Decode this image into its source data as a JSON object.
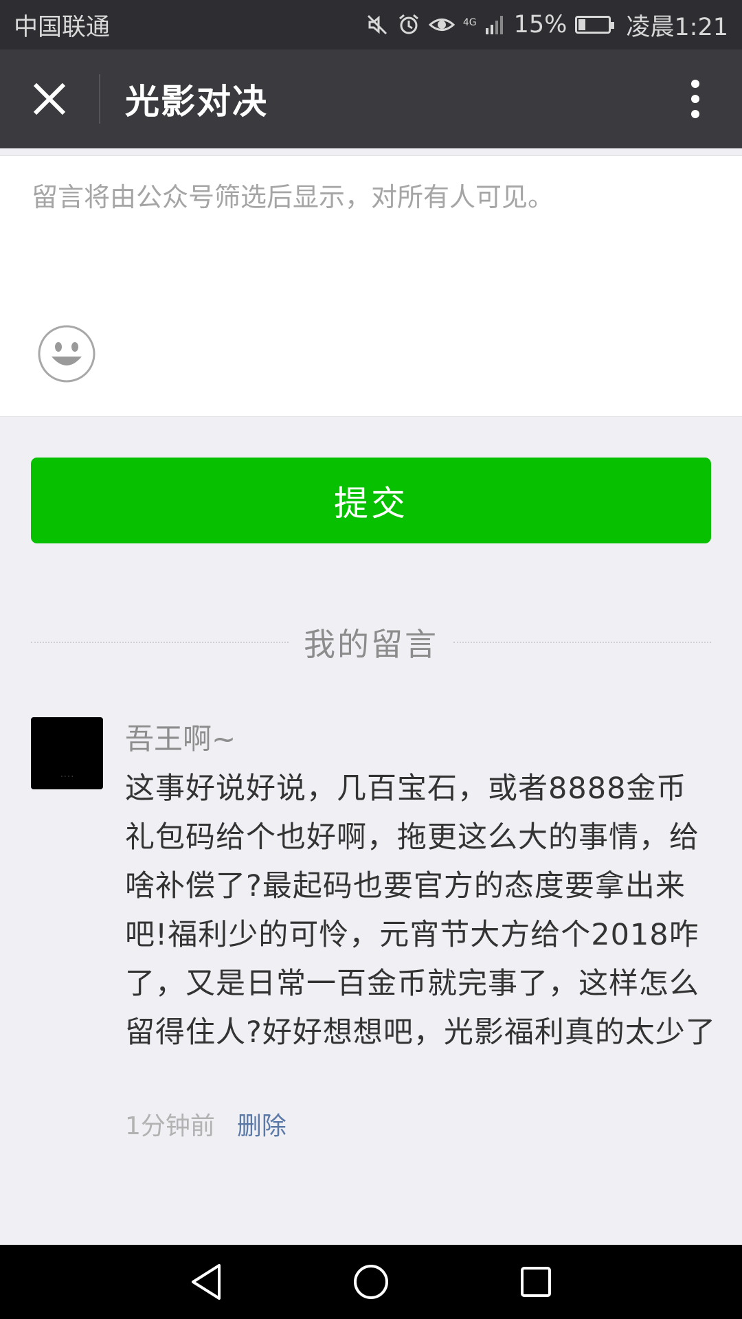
{
  "status_bar": {
    "carrier": "中国联通",
    "network": "4G",
    "battery": "15%",
    "time": "凌晨1:21"
  },
  "title_bar": {
    "title": "光影对决",
    "close_icon": "close-icon",
    "more_icon": "more-vertical-icon"
  },
  "comment_box": {
    "placeholder": "留言将由公众号筛选后显示，对所有人可见。",
    "emoji_icon": "emoji-smile-icon"
  },
  "submit": {
    "label": "提交",
    "color": "#07c100"
  },
  "my_comments": {
    "heading": "我的留言",
    "items": [
      {
        "nickname": "吾王啊~",
        "text": "这事好说好说，几百宝石，或者8888金币礼包码给个也好啊，拖更这么大的事情，给啥补偿了?最起码也要官方的态度要拿出来吧!福利少的可怜，元宵节大方给个2018咋了，又是日常一百金币就完事了，这样怎么留得住人?好好想想吧，光影福利真的太少了",
        "time": "1分钟前",
        "delete_label": "删除"
      }
    ]
  },
  "nav_bar": {
    "back_icon": "back-triangle-icon",
    "home_icon": "home-circle-icon",
    "recents_icon": "recents-square-icon"
  }
}
